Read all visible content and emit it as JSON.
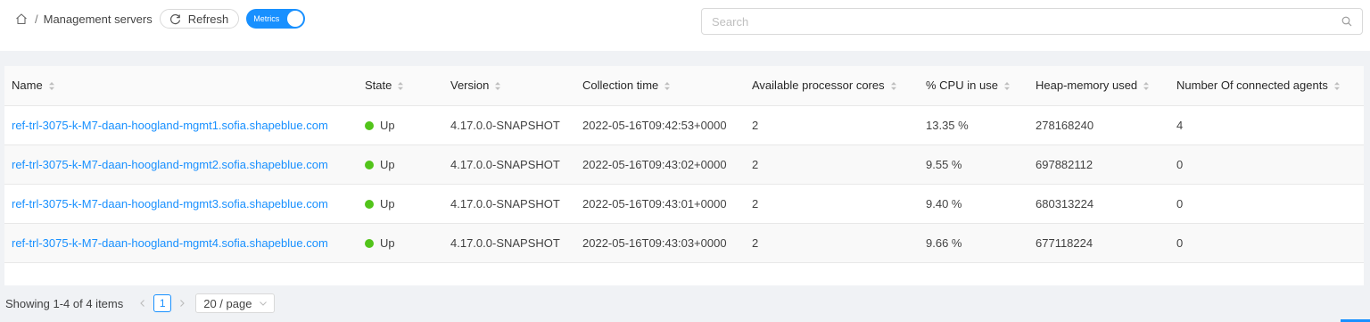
{
  "breadcrumb": {
    "separator": "/",
    "current": "Management servers"
  },
  "toolbar": {
    "refresh_label": "Refresh",
    "metrics_toggle_label": "Metrics",
    "metrics_enabled": true
  },
  "search": {
    "placeholder": "Search",
    "value": ""
  },
  "table": {
    "columns": [
      "Name",
      "State",
      "Version",
      "Collection time",
      "Available processor cores",
      "% CPU in use",
      "Heap-memory used",
      "Number Of connected agents"
    ],
    "rows": [
      {
        "name": "ref-trl-3075-k-M7-daan-hoogland-mgmt1.sofia.shapeblue.com",
        "state": "Up",
        "version": "4.17.0.0-SNAPSHOT",
        "collection_time": "2022-05-16T09:42:53+0000",
        "cores": "2",
        "cpu": "13.35 %",
        "heap": "278168240",
        "agents": "4"
      },
      {
        "name": "ref-trl-3075-k-M7-daan-hoogland-mgmt2.sofia.shapeblue.com",
        "state": "Up",
        "version": "4.17.0.0-SNAPSHOT",
        "collection_time": "2022-05-16T09:43:02+0000",
        "cores": "2",
        "cpu": "9.55 %",
        "heap": "697882112",
        "agents": "0"
      },
      {
        "name": "ref-trl-3075-k-M7-daan-hoogland-mgmt3.sofia.shapeblue.com",
        "state": "Up",
        "version": "4.17.0.0-SNAPSHOT",
        "collection_time": "2022-05-16T09:43:01+0000",
        "cores": "2",
        "cpu": "9.40 %",
        "heap": "680313224",
        "agents": "0"
      },
      {
        "name": "ref-trl-3075-k-M7-daan-hoogland-mgmt4.sofia.shapeblue.com",
        "state": "Up",
        "version": "4.17.0.0-SNAPSHOT",
        "collection_time": "2022-05-16T09:43:03+0000",
        "cores": "2",
        "cpu": "9.66 %",
        "heap": "677118224",
        "agents": "0"
      }
    ]
  },
  "pagination": {
    "summary": "Showing 1-4 of 4 items",
    "current_page": "1",
    "page_size_label": "20 / page"
  },
  "colors": {
    "accent": "#1890ff",
    "state_up": "#52c41a"
  },
  "icons": {
    "home": "home-icon",
    "refresh": "refresh-icon",
    "search": "search-icon",
    "sort": "sort-icon",
    "prev": "chevron-left-icon",
    "next": "chevron-right-icon",
    "dropdown": "chevron-down-icon"
  }
}
